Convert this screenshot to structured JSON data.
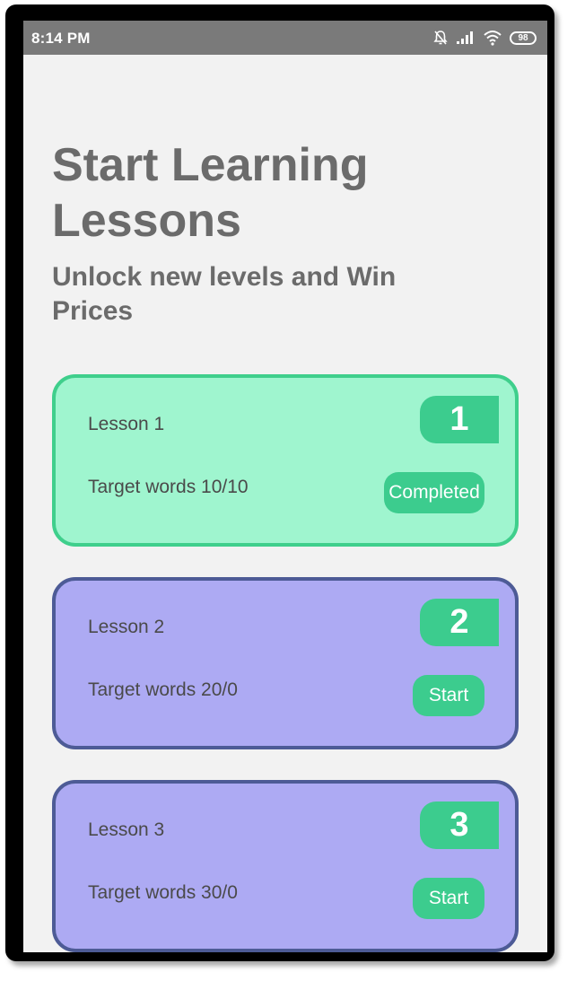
{
  "status_bar": {
    "time": "8:14 PM",
    "battery": "98",
    "icons": [
      "mute-bell-icon",
      "signal-icon",
      "wifi-icon",
      "battery-icon"
    ]
  },
  "header": {
    "title": "Start Learning Lessons",
    "subtitle": "Unlock new levels and Win Prices"
  },
  "colors": {
    "completed_card_bg": "#9ff5cf",
    "completed_card_border": "#3fcf8c",
    "pending_card_bg": "#adaaf3",
    "pending_card_border": "#4d5b96",
    "accent": "#3ccc8e"
  },
  "lessons": [
    {
      "label": "Lesson 1",
      "number": "1",
      "target": "Target words 10/10",
      "action": "Completed"
    },
    {
      "label": "Lesson 2",
      "number": "2",
      "target": "Target words 20/0",
      "action": "Start"
    },
    {
      "label": "Lesson 3",
      "number": "3",
      "target": "Target words 30/0",
      "action": "Start"
    }
  ]
}
